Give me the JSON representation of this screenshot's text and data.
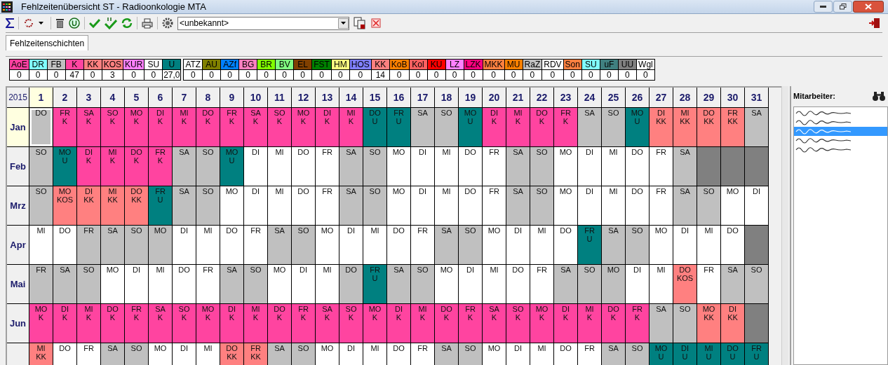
{
  "window": {
    "title": "Fehlzeitenübersicht ST - Radioonkologie MTA"
  },
  "toolbar": {
    "combo_value": "<unbekannt>"
  },
  "tabs": [
    {
      "label": "Fehlzeitenschichten",
      "selected": true
    }
  ],
  "legend": {
    "groups": [
      [
        {
          "code": "AoE",
          "color": "#ff40a0",
          "count": "0"
        },
        {
          "code": "DR",
          "color": "#80ffff",
          "count": "0"
        },
        {
          "code": "FB",
          "color": "#c0c0c0",
          "count": "0"
        },
        {
          "code": "K",
          "color": "#ff44a0",
          "count": "47"
        },
        {
          "code": "KK",
          "color": "#ff8080",
          "count": "0"
        },
        {
          "code": "KOS",
          "color": "#ff8080",
          "count": "3"
        },
        {
          "code": "KUR",
          "color": "#ff80ff",
          "count": "0"
        },
        {
          "code": "SU",
          "color": "#ffffff",
          "count": "0"
        },
        {
          "code": "U",
          "color": "#008080",
          "count": "27,0"
        }
      ],
      [
        {
          "code": "ATZ",
          "color": "#ffffff",
          "count": "0"
        },
        {
          "code": "AU",
          "color": "#808000",
          "count": "0"
        },
        {
          "code": "AZf",
          "color": "#0080ff",
          "count": "0"
        },
        {
          "code": "BG",
          "color": "#ff80c0",
          "count": "0"
        },
        {
          "code": "BR",
          "color": "#80ff00",
          "count": "0"
        },
        {
          "code": "BV",
          "color": "#80ff80",
          "count": "0"
        },
        {
          "code": "EL",
          "color": "#804000",
          "count": "0"
        },
        {
          "code": "FST",
          "color": "#008000",
          "count": "0"
        },
        {
          "code": "HM",
          "color": "#ffff80",
          "count": "0"
        },
        {
          "code": "HOS",
          "color": "#8080ff",
          "count": "0"
        },
        {
          "code": "KK",
          "color": "#ff8080",
          "count": "14"
        },
        {
          "code": "KoB",
          "color": "#ff8000",
          "count": "0"
        },
        {
          "code": "Kol",
          "color": "#ff6060",
          "count": "0"
        },
        {
          "code": "KU",
          "color": "#ff0000",
          "count": "0"
        },
        {
          "code": "LZ",
          "color": "#ff80ff",
          "count": "0"
        },
        {
          "code": "LZK",
          "color": "#ff0080",
          "count": "0"
        },
        {
          "code": "MKK",
          "color": "#ff8040",
          "count": "0"
        },
        {
          "code": "MU",
          "color": "#ff8000",
          "count": "0"
        },
        {
          "code": "RaZ",
          "color": "#c0c0c0",
          "count": "0"
        },
        {
          "code": "RDV",
          "color": "#ffffff",
          "count": "0"
        },
        {
          "code": "Son",
          "color": "#ff8040",
          "count": "0"
        },
        {
          "code": "SU",
          "color": "#80ffff",
          "count": "0"
        },
        {
          "code": "uF",
          "color": "#408080",
          "count": "0"
        },
        {
          "code": "UU",
          "color": "#808080",
          "count": "0"
        },
        {
          "code": "Wgl",
          "color": "#ffffff",
          "count": "0"
        }
      ]
    ]
  },
  "calendar": {
    "year": "2015",
    "days": [
      {
        "label": "1",
        "selected": true
      },
      {
        "label": "2",
        "selected": false
      },
      {
        "label": "3",
        "selected": false
      },
      {
        "label": "4",
        "selected": false
      },
      {
        "label": "5",
        "selected": false
      },
      {
        "label": "6",
        "selected": false
      },
      {
        "label": "7",
        "selected": false
      },
      {
        "label": "8",
        "selected": false
      },
      {
        "label": "9",
        "selected": false
      },
      {
        "label": "10",
        "selected": false
      },
      {
        "label": "11",
        "selected": false
      },
      {
        "label": "12",
        "selected": false
      },
      {
        "label": "13",
        "selected": false
      },
      {
        "label": "14",
        "selected": false
      },
      {
        "label": "15",
        "selected": false
      },
      {
        "label": "16",
        "selected": false
      },
      {
        "label": "17",
        "selected": false
      },
      {
        "label": "18",
        "selected": false
      },
      {
        "label": "19",
        "selected": false
      },
      {
        "label": "20",
        "selected": false
      },
      {
        "label": "21",
        "selected": false
      },
      {
        "label": "22",
        "selected": false
      },
      {
        "label": "23",
        "selected": false
      },
      {
        "label": "24",
        "selected": false
      },
      {
        "label": "25",
        "selected": false
      },
      {
        "label": "26",
        "selected": false
      },
      {
        "label": "27",
        "selected": false
      },
      {
        "label": "28",
        "selected": false
      },
      {
        "label": "29",
        "selected": false
      },
      {
        "label": "30",
        "selected": false
      },
      {
        "label": "31",
        "selected": false
      }
    ],
    "months": [
      {
        "label": "Jan",
        "selected": true,
        "cells": [
          {
            "weekday": "DO",
            "kind": "free"
          },
          {
            "weekday": "FR",
            "kind": "absence",
            "code": "K",
            "color": "#ff44a0"
          },
          {
            "weekday": "SA",
            "kind": "absence",
            "code": "K",
            "color": "#ff44a0"
          },
          {
            "weekday": "SO",
            "kind": "absence",
            "code": "K",
            "color": "#ff44a0"
          },
          {
            "weekday": "MO",
            "kind": "absence",
            "code": "K",
            "color": "#ff44a0"
          },
          {
            "weekday": "DI",
            "kind": "absence",
            "code": "K",
            "color": "#ff44a0"
          },
          {
            "weekday": "MI",
            "kind": "absence",
            "code": "K",
            "color": "#ff44a0"
          },
          {
            "weekday": "DO",
            "kind": "absence",
            "code": "K",
            "color": "#ff44a0"
          },
          {
            "weekday": "FR",
            "kind": "absence",
            "code": "K",
            "color": "#ff44a0"
          },
          {
            "weekday": "SA",
            "kind": "absence",
            "code": "K",
            "color": "#ff44a0"
          },
          {
            "weekday": "SO",
            "kind": "absence",
            "code": "K",
            "color": "#ff44a0"
          },
          {
            "weekday": "MO",
            "kind": "absence",
            "code": "K",
            "color": "#ff44a0"
          },
          {
            "weekday": "DI",
            "kind": "absence",
            "code": "K",
            "color": "#ff44a0"
          },
          {
            "weekday": "MI",
            "kind": "absence",
            "code": "K",
            "color": "#ff44a0"
          },
          {
            "weekday": "DO",
            "kind": "absence",
            "code": "U",
            "color": "#008080"
          },
          {
            "weekday": "FR",
            "kind": "absence",
            "code": "U",
            "color": "#008080"
          },
          {
            "weekday": "SA",
            "kind": "free"
          },
          {
            "weekday": "SO",
            "kind": "free"
          },
          {
            "weekday": "MO",
            "kind": "absence",
            "code": "U",
            "color": "#008080"
          },
          {
            "weekday": "DI",
            "kind": "absence",
            "code": "K",
            "color": "#ff44a0"
          },
          {
            "weekday": "MI",
            "kind": "absence",
            "code": "K",
            "color": "#ff44a0"
          },
          {
            "weekday": "DO",
            "kind": "absence",
            "code": "K",
            "color": "#ff44a0"
          },
          {
            "weekday": "FR",
            "kind": "absence",
            "code": "K",
            "color": "#ff44a0"
          },
          {
            "weekday": "SA",
            "kind": "free"
          },
          {
            "weekday": "SO",
            "kind": "free"
          },
          {
            "weekday": "MO",
            "kind": "absence",
            "code": "U",
            "color": "#008080"
          },
          {
            "weekday": "DI",
            "kind": "absence",
            "code": "KK",
            "color": "#ff8080"
          },
          {
            "weekday": "MI",
            "kind": "absence",
            "code": "KK",
            "color": "#ff8080"
          },
          {
            "weekday": "DO",
            "kind": "absence",
            "code": "KK",
            "color": "#ff8080"
          },
          {
            "weekday": "FR",
            "kind": "absence",
            "code": "KK",
            "color": "#ff8080"
          },
          {
            "weekday": "SA",
            "kind": "free"
          }
        ]
      },
      {
        "label": "Feb",
        "selected": false,
        "cells": [
          {
            "weekday": "SO",
            "kind": "free"
          },
          {
            "weekday": "MO",
            "kind": "absence",
            "code": "U",
            "color": "#008080"
          },
          {
            "weekday": "DI",
            "kind": "absence",
            "code": "K",
            "color": "#ff44a0"
          },
          {
            "weekday": "MI",
            "kind": "absence",
            "code": "K",
            "color": "#ff44a0"
          },
          {
            "weekday": "DO",
            "kind": "absence",
            "code": "K",
            "color": "#ff44a0"
          },
          {
            "weekday": "FR",
            "kind": "absence",
            "code": "K",
            "color": "#ff44a0"
          },
          {
            "weekday": "SA",
            "kind": "free"
          },
          {
            "weekday": "SO",
            "kind": "free"
          },
          {
            "weekday": "MO",
            "kind": "absence",
            "code": "U",
            "color": "#008080"
          },
          {
            "weekday": "DI",
            "kind": "work"
          },
          {
            "weekday": "MI",
            "kind": "work"
          },
          {
            "weekday": "DO",
            "kind": "work"
          },
          {
            "weekday": "FR",
            "kind": "work"
          },
          {
            "weekday": "SA",
            "kind": "free"
          },
          {
            "weekday": "SO",
            "kind": "free"
          },
          {
            "weekday": "MO",
            "kind": "work"
          },
          {
            "weekday": "DI",
            "kind": "work"
          },
          {
            "weekday": "MI",
            "kind": "work"
          },
          {
            "weekday": "DO",
            "kind": "work"
          },
          {
            "weekday": "FR",
            "kind": "work"
          },
          {
            "weekday": "SA",
            "kind": "free"
          },
          {
            "weekday": "SO",
            "kind": "free"
          },
          {
            "weekday": "MO",
            "kind": "work"
          },
          {
            "weekday": "DI",
            "kind": "work"
          },
          {
            "weekday": "MI",
            "kind": "work"
          },
          {
            "weekday": "DO",
            "kind": "work"
          },
          {
            "weekday": "FR",
            "kind": "work"
          },
          {
            "weekday": "SA",
            "kind": "free"
          },
          {
            "kind": "none"
          },
          {
            "kind": "none"
          },
          {
            "kind": "none"
          }
        ]
      },
      {
        "label": "Mrz",
        "selected": false,
        "cells": [
          {
            "weekday": "SO",
            "kind": "free"
          },
          {
            "weekday": "MO",
            "kind": "absence",
            "code": "KOS",
            "color": "#ff8080"
          },
          {
            "weekday": "DI",
            "kind": "absence",
            "code": "KK",
            "color": "#ff8080"
          },
          {
            "weekday": "MI",
            "kind": "absence",
            "code": "KK",
            "color": "#ff8080"
          },
          {
            "weekday": "DO",
            "kind": "absence",
            "code": "KK",
            "color": "#ff8080"
          },
          {
            "weekday": "FR",
            "kind": "absence",
            "code": "U",
            "color": "#008080"
          },
          {
            "weekday": "SA",
            "kind": "free"
          },
          {
            "weekday": "SO",
            "kind": "free"
          },
          {
            "weekday": "MO",
            "kind": "work"
          },
          {
            "weekday": "DI",
            "kind": "work"
          },
          {
            "weekday": "MI",
            "kind": "work"
          },
          {
            "weekday": "DO",
            "kind": "work"
          },
          {
            "weekday": "FR",
            "kind": "work"
          },
          {
            "weekday": "SA",
            "kind": "free"
          },
          {
            "weekday": "SO",
            "kind": "free"
          },
          {
            "weekday": "MO",
            "kind": "work"
          },
          {
            "weekday": "DI",
            "kind": "work"
          },
          {
            "weekday": "MI",
            "kind": "work"
          },
          {
            "weekday": "DO",
            "kind": "work"
          },
          {
            "weekday": "FR",
            "kind": "work"
          },
          {
            "weekday": "SA",
            "kind": "free"
          },
          {
            "weekday": "SO",
            "kind": "free"
          },
          {
            "weekday": "MO",
            "kind": "work"
          },
          {
            "weekday": "DI",
            "kind": "work"
          },
          {
            "weekday": "MI",
            "kind": "work"
          },
          {
            "weekday": "DO",
            "kind": "work"
          },
          {
            "weekday": "FR",
            "kind": "work"
          },
          {
            "weekday": "SA",
            "kind": "free"
          },
          {
            "weekday": "SO",
            "kind": "free"
          },
          {
            "weekday": "MO",
            "kind": "work"
          },
          {
            "weekday": "DI",
            "kind": "work"
          }
        ]
      },
      {
        "label": "Apr",
        "selected": false,
        "cells": [
          {
            "weekday": "MI",
            "kind": "work"
          },
          {
            "weekday": "DO",
            "kind": "work"
          },
          {
            "weekday": "FR",
            "kind": "free"
          },
          {
            "weekday": "SA",
            "kind": "free"
          },
          {
            "weekday": "SO",
            "kind": "free"
          },
          {
            "weekday": "MO",
            "kind": "free"
          },
          {
            "weekday": "DI",
            "kind": "work"
          },
          {
            "weekday": "MI",
            "kind": "work"
          },
          {
            "weekday": "DO",
            "kind": "work"
          },
          {
            "weekday": "FR",
            "kind": "work"
          },
          {
            "weekday": "SA",
            "kind": "free"
          },
          {
            "weekday": "SO",
            "kind": "free"
          },
          {
            "weekday": "MO",
            "kind": "work"
          },
          {
            "weekday": "DI",
            "kind": "work"
          },
          {
            "weekday": "MI",
            "kind": "work"
          },
          {
            "weekday": "DO",
            "kind": "work"
          },
          {
            "weekday": "FR",
            "kind": "work"
          },
          {
            "weekday": "SA",
            "kind": "free"
          },
          {
            "weekday": "SO",
            "kind": "free"
          },
          {
            "weekday": "MO",
            "kind": "work"
          },
          {
            "weekday": "DI",
            "kind": "work"
          },
          {
            "weekday": "MI",
            "kind": "work"
          },
          {
            "weekday": "DO",
            "kind": "work"
          },
          {
            "weekday": "FR",
            "kind": "absence",
            "code": "U",
            "color": "#008080"
          },
          {
            "weekday": "SA",
            "kind": "free"
          },
          {
            "weekday": "SO",
            "kind": "free"
          },
          {
            "weekday": "MO",
            "kind": "work"
          },
          {
            "weekday": "DI",
            "kind": "work"
          },
          {
            "weekday": "MI",
            "kind": "work"
          },
          {
            "weekday": "DO",
            "kind": "work"
          },
          {
            "kind": "none"
          }
        ]
      },
      {
        "label": "Mai",
        "selected": false,
        "cells": [
          {
            "weekday": "FR",
            "kind": "free"
          },
          {
            "weekday": "SA",
            "kind": "free"
          },
          {
            "weekday": "SO",
            "kind": "free"
          },
          {
            "weekday": "MO",
            "kind": "work"
          },
          {
            "weekday": "DI",
            "kind": "work"
          },
          {
            "weekday": "MI",
            "kind": "work"
          },
          {
            "weekday": "DO",
            "kind": "work"
          },
          {
            "weekday": "FR",
            "kind": "work"
          },
          {
            "weekday": "SA",
            "kind": "free"
          },
          {
            "weekday": "SO",
            "kind": "free"
          },
          {
            "weekday": "MO",
            "kind": "work"
          },
          {
            "weekday": "DI",
            "kind": "work"
          },
          {
            "weekday": "MI",
            "kind": "work"
          },
          {
            "weekday": "DO",
            "kind": "free"
          },
          {
            "weekday": "FR",
            "kind": "absence",
            "code": "U",
            "color": "#008080"
          },
          {
            "weekday": "SA",
            "kind": "free"
          },
          {
            "weekday": "SO",
            "kind": "free"
          },
          {
            "weekday": "MO",
            "kind": "work"
          },
          {
            "weekday": "DI",
            "kind": "work"
          },
          {
            "weekday": "MI",
            "kind": "work"
          },
          {
            "weekday": "DO",
            "kind": "work"
          },
          {
            "weekday": "FR",
            "kind": "work"
          },
          {
            "weekday": "SA",
            "kind": "free"
          },
          {
            "weekday": "SO",
            "kind": "free"
          },
          {
            "weekday": "MO",
            "kind": "free"
          },
          {
            "weekday": "DI",
            "kind": "work"
          },
          {
            "weekday": "MI",
            "kind": "work"
          },
          {
            "weekday": "DO",
            "kind": "absence",
            "code": "KOS",
            "color": "#ff8080"
          },
          {
            "weekday": "FR",
            "kind": "work"
          },
          {
            "weekday": "SA",
            "kind": "free"
          },
          {
            "weekday": "SO",
            "kind": "free"
          }
        ]
      },
      {
        "label": "Jun",
        "selected": false,
        "cells": [
          {
            "weekday": "MO",
            "kind": "absence",
            "code": "K",
            "color": "#ff44a0"
          },
          {
            "weekday": "DI",
            "kind": "absence",
            "code": "K",
            "color": "#ff44a0"
          },
          {
            "weekday": "MI",
            "kind": "absence",
            "code": "K",
            "color": "#ff44a0"
          },
          {
            "weekday": "DO",
            "kind": "absence",
            "code": "K",
            "color": "#ff44a0"
          },
          {
            "weekday": "FR",
            "kind": "absence",
            "code": "K",
            "color": "#ff44a0"
          },
          {
            "weekday": "SA",
            "kind": "absence",
            "code": "K",
            "color": "#ff44a0"
          },
          {
            "weekday": "SO",
            "kind": "absence",
            "code": "K",
            "color": "#ff44a0"
          },
          {
            "weekday": "MO",
            "kind": "absence",
            "code": "K",
            "color": "#ff44a0"
          },
          {
            "weekday": "DI",
            "kind": "absence",
            "code": "K",
            "color": "#ff44a0"
          },
          {
            "weekday": "MI",
            "kind": "absence",
            "code": "K",
            "color": "#ff44a0"
          },
          {
            "weekday": "DO",
            "kind": "absence",
            "code": "K",
            "color": "#ff44a0"
          },
          {
            "weekday": "FR",
            "kind": "absence",
            "code": "K",
            "color": "#ff44a0"
          },
          {
            "weekday": "SA",
            "kind": "absence",
            "code": "K",
            "color": "#ff44a0"
          },
          {
            "weekday": "SO",
            "kind": "absence",
            "code": "K",
            "color": "#ff44a0"
          },
          {
            "weekday": "MO",
            "kind": "absence",
            "code": "K",
            "color": "#ff44a0"
          },
          {
            "weekday": "DI",
            "kind": "absence",
            "code": "K",
            "color": "#ff44a0"
          },
          {
            "weekday": "MI",
            "kind": "absence",
            "code": "K",
            "color": "#ff44a0"
          },
          {
            "weekday": "DO",
            "kind": "absence",
            "code": "K",
            "color": "#ff44a0"
          },
          {
            "weekday": "FR",
            "kind": "absence",
            "code": "K",
            "color": "#ff44a0"
          },
          {
            "weekday": "SA",
            "kind": "absence",
            "code": "K",
            "color": "#ff44a0"
          },
          {
            "weekday": "SO",
            "kind": "absence",
            "code": "K",
            "color": "#ff44a0"
          },
          {
            "weekday": "MO",
            "kind": "absence",
            "code": "K",
            "color": "#ff44a0"
          },
          {
            "weekday": "DI",
            "kind": "absence",
            "code": "K",
            "color": "#ff44a0"
          },
          {
            "weekday": "MI",
            "kind": "absence",
            "code": "K",
            "color": "#ff44a0"
          },
          {
            "weekday": "DO",
            "kind": "absence",
            "code": "K",
            "color": "#ff44a0"
          },
          {
            "weekday": "FR",
            "kind": "absence",
            "code": "K",
            "color": "#ff44a0"
          },
          {
            "weekday": "SA",
            "kind": "free"
          },
          {
            "weekday": "SO",
            "kind": "free"
          },
          {
            "weekday": "MO",
            "kind": "absence",
            "code": "KK",
            "color": "#ff8080"
          },
          {
            "weekday": "DI",
            "kind": "absence",
            "code": "KK",
            "color": "#ff8080"
          },
          {
            "kind": "none"
          }
        ]
      },
      {
        "selected": false,
        "cells": [
          {
            "weekday": "MI",
            "kind": "absence",
            "code": "KK",
            "color": "#ff8080"
          },
          {
            "weekday": "DO",
            "kind": "work"
          },
          {
            "weekday": "FR",
            "kind": "work"
          },
          {
            "weekday": "SA",
            "kind": "free"
          },
          {
            "weekday": "SO",
            "kind": "free"
          },
          {
            "weekday": "MO",
            "kind": "work"
          },
          {
            "weekday": "DI",
            "kind": "work"
          },
          {
            "weekday": "MI",
            "kind": "work"
          },
          {
            "weekday": "DO",
            "kind": "absence",
            "code": "KK",
            "color": "#ff8080"
          },
          {
            "weekday": "FR",
            "kind": "absence",
            "code": "KK",
            "color": "#ff8080"
          },
          {
            "weekday": "SA",
            "kind": "free"
          },
          {
            "weekday": "SO",
            "kind": "free"
          },
          {
            "weekday": "MO",
            "kind": "work"
          },
          {
            "weekday": "DI",
            "kind": "work"
          },
          {
            "weekday": "MI",
            "kind": "work"
          },
          {
            "weekday": "DO",
            "kind": "work"
          },
          {
            "weekday": "FR",
            "kind": "work"
          },
          {
            "weekday": "SA",
            "kind": "free"
          },
          {
            "weekday": "SO",
            "kind": "free"
          },
          {
            "weekday": "MO",
            "kind": "work"
          },
          {
            "weekday": "DI",
            "kind": "work"
          },
          {
            "weekday": "MI",
            "kind": "work"
          },
          {
            "weekday": "DO",
            "kind": "work"
          },
          {
            "weekday": "FR",
            "kind": "work"
          },
          {
            "weekday": "SA",
            "kind": "free"
          },
          {
            "weekday": "SO",
            "kind": "free"
          },
          {
            "weekday": "MO",
            "kind": "absence",
            "code": "U",
            "color": "#008080"
          },
          {
            "weekday": "DI",
            "kind": "absence",
            "code": "U",
            "color": "#008080"
          },
          {
            "weekday": "MI",
            "kind": "absence",
            "code": "U",
            "color": "#008080"
          },
          {
            "weekday": "DO",
            "kind": "absence",
            "code": "U",
            "color": "#008080"
          },
          {
            "weekday": "FR",
            "kind": "absence",
            "code": "U",
            "color": "#008080"
          }
        ]
      }
    ]
  },
  "employees": {
    "title": "Mitarbeiter:",
    "items": [
      {
        "selected": false
      },
      {
        "selected": false
      },
      {
        "selected": true
      },
      {
        "selected": false
      },
      {
        "selected": false
      }
    ]
  }
}
